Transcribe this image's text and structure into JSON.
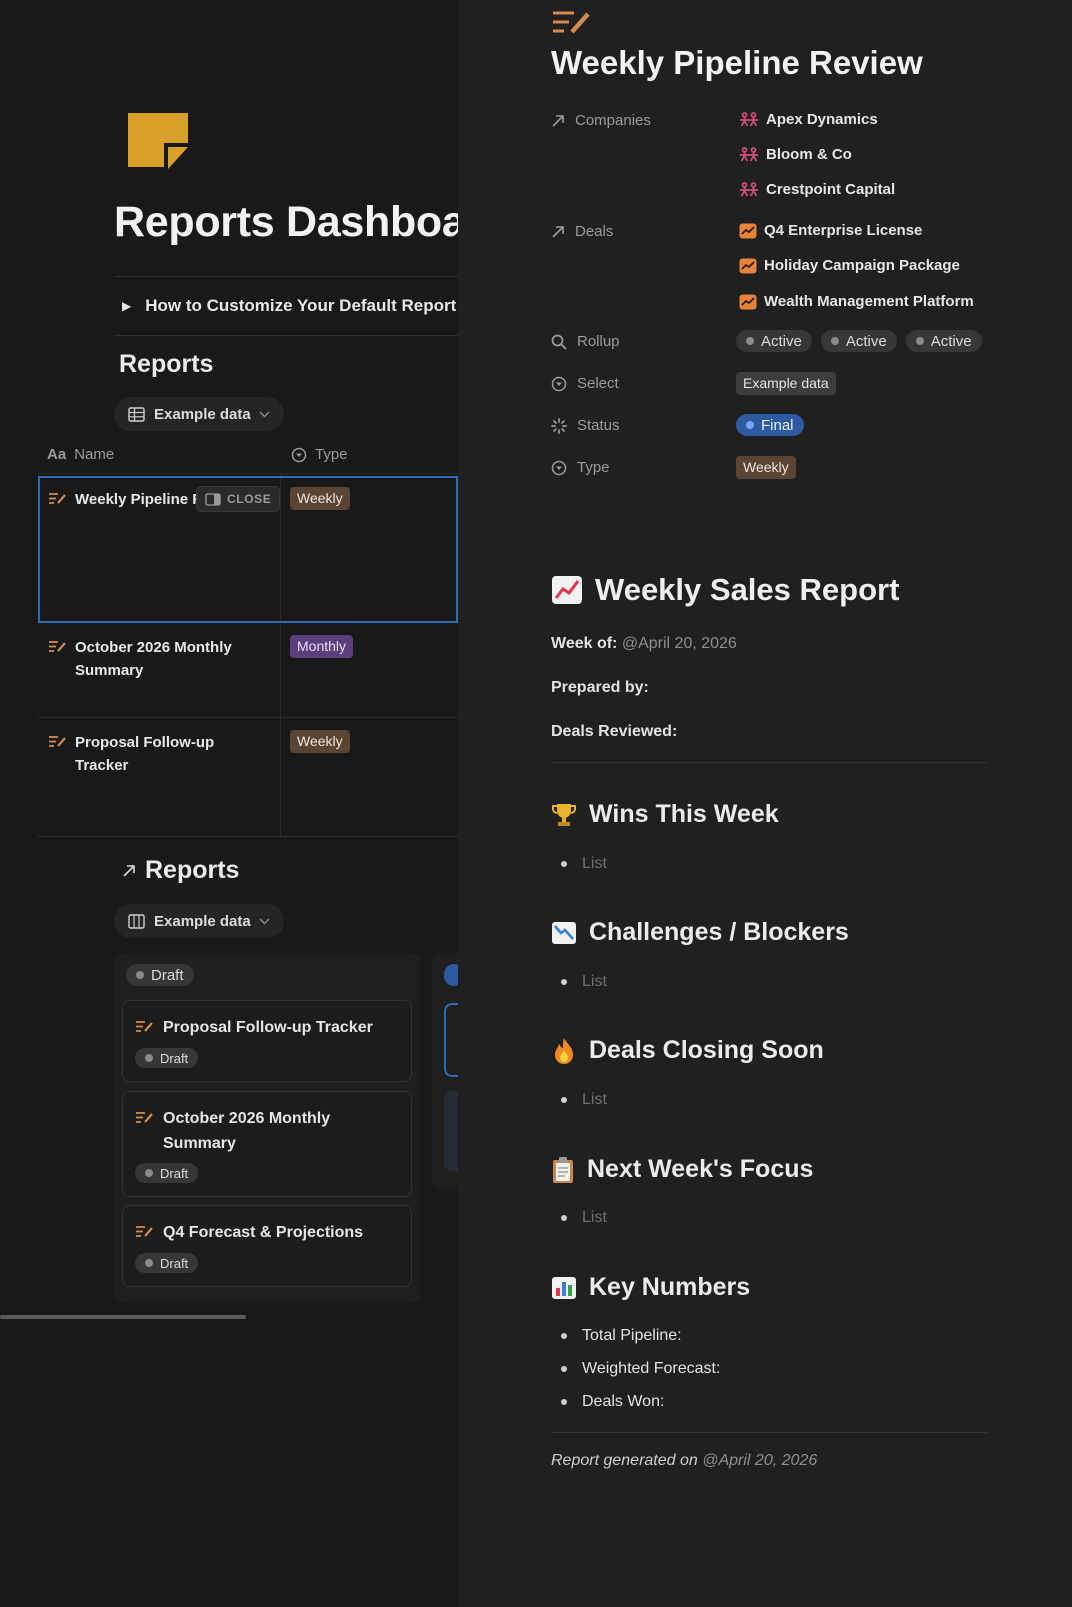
{
  "left": {
    "page_title": "Reports Dashboard",
    "toggle_label": "How to Customize Your Default Report",
    "table_section": {
      "title": "Reports",
      "view_label": "Example data",
      "columns": {
        "name": "Name",
        "type": "Type"
      },
      "close_label": "CLOSE",
      "rows": [
        {
          "name": "Weekly Pipeline Review",
          "type": "Weekly"
        },
        {
          "name": "October 2026 Monthly Summary",
          "type": "Monthly"
        },
        {
          "name": "Proposal Follow-up Tracker",
          "type": "Weekly"
        }
      ]
    },
    "board_section": {
      "title": "Reports",
      "view_label": "Example data",
      "group_label": "Draft",
      "cards": [
        {
          "title": "Proposal Follow-up Tracker",
          "status": "Draft"
        },
        {
          "title": "October 2026 Monthly Summary",
          "status": "Draft"
        },
        {
          "title": "Q4 Forecast & Projections",
          "status": "Draft"
        }
      ]
    }
  },
  "right": {
    "title": "Weekly Pipeline Review",
    "properties": {
      "companies_label": "Companies",
      "companies": [
        "Apex Dynamics",
        "Bloom & Co",
        "Crestpoint Capital"
      ],
      "deals_label": "Deals",
      "deals": [
        "Q4 Enterprise License",
        "Holiday Campaign Package",
        "Wealth Management Platform"
      ],
      "rollup_label": "Rollup",
      "rollup_values": [
        "Active",
        "Active",
        "Active"
      ],
      "select_label": "Select",
      "select_value": "Example data",
      "status_label": "Status",
      "status_value": "Final",
      "type_label": "Type",
      "type_value": "Weekly"
    },
    "doc": {
      "heading": "Weekly Sales Report",
      "week_of_label": "Week of:",
      "week_of_value": "@April 20, 2026",
      "prepared_by_label": "Prepared by:",
      "deals_reviewed_label": "Deals Reviewed:",
      "sections": [
        {
          "title": "Wins This Week",
          "item": "List"
        },
        {
          "title": "Challenges / Blockers",
          "item": "List"
        },
        {
          "title": "Deals Closing Soon",
          "item": "List"
        },
        {
          "title": "Next Week's Focus",
          "item": "List"
        }
      ],
      "key_numbers_title": "Key Numbers",
      "key_numbers": [
        "Total Pipeline:",
        "Weighted Forecast:",
        "Deals Won:"
      ],
      "footer_text": "Report generated on",
      "footer_date": "@April 20, 2026"
    }
  },
  "colors": {
    "background": "#191919",
    "peek_background": "#202020",
    "selection_border": "#2f6cb8",
    "logo": "#d9a02a",
    "company_icon": "#d64d7c",
    "deal_icon": "#e8843a"
  }
}
